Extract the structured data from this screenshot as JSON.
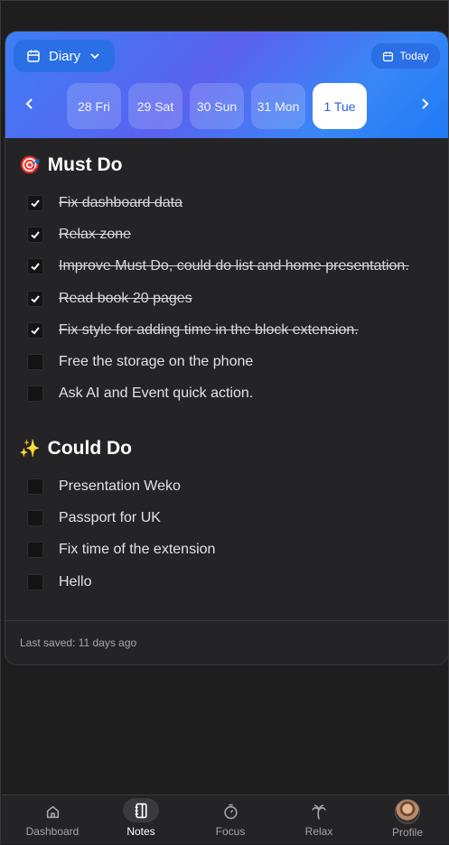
{
  "header": {
    "diary_label": "Diary",
    "today_label": "Today",
    "dates": [
      {
        "label": "28 Fri",
        "active": false
      },
      {
        "label": "29 Sat",
        "active": false
      },
      {
        "label": "30 Sun",
        "active": false
      },
      {
        "label": "31 Mon",
        "active": false
      },
      {
        "label": "1 Tue",
        "active": true
      }
    ]
  },
  "must_do": {
    "emoji": "🎯",
    "title": "Must Do",
    "tasks": [
      {
        "text": "Fix dashboard data",
        "done": true
      },
      {
        "text": "Relax zone",
        "done": true
      },
      {
        "text": "Improve Must Do, could do list and home presentation.",
        "done": true
      },
      {
        "text": "Read book 20 pages",
        "done": true
      },
      {
        "text": "Fix style for adding time in the block extension.",
        "done": true
      },
      {
        "text": "Free the storage on the phone",
        "done": false
      },
      {
        "text": "Ask AI and Event quick action.",
        "done": false
      }
    ]
  },
  "could_do": {
    "emoji": "✨",
    "title": "Could Do",
    "tasks": [
      {
        "text": "Presentation Weko",
        "done": false
      },
      {
        "text": "Passport for UK",
        "done": false
      },
      {
        "text": "Fix time of the extension",
        "done": false
      },
      {
        "text": "Hello",
        "done": false
      }
    ]
  },
  "footer": {
    "last_saved": "Last saved: 11 days ago"
  },
  "bottom_nav": [
    {
      "label": "Dashboard",
      "icon": "home-icon",
      "active": false
    },
    {
      "label": "Notes",
      "icon": "notebook-icon",
      "active": true
    },
    {
      "label": "Focus",
      "icon": "timer-icon",
      "active": false
    },
    {
      "label": "Relax",
      "icon": "palm-tree-icon",
      "active": false
    },
    {
      "label": "Profile",
      "icon": "avatar",
      "active": false
    }
  ],
  "colors": {
    "accent": "#2f7bf6",
    "header_gradient_mid": "#5a62ef",
    "background": "#1e1e1f",
    "card": "#242426"
  }
}
